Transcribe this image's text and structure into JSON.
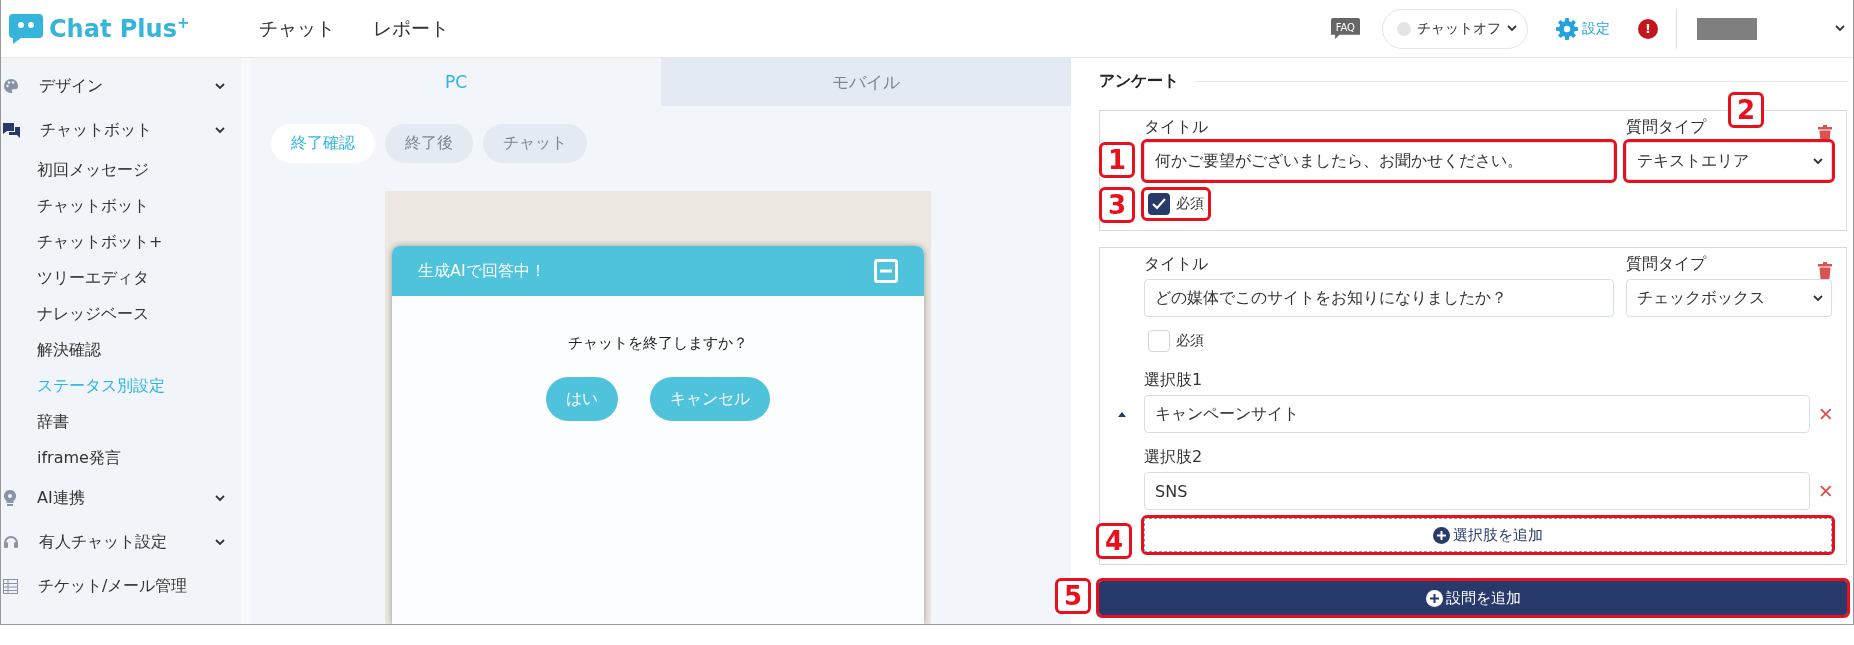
{
  "header": {
    "logo": "Chat Plus$^{+}$",
    "nav": [
      {
        "label": "チャット"
      },
      {
        "label": "レポート"
      }
    ],
    "faq": "FAQ",
    "status": {
      "label": "チャットオフ",
      "on": false
    },
    "settings": "設定",
    "alert": "!"
  },
  "sidebar": {
    "items": [
      {
        "label": "デザイン",
        "kind": "group"
      },
      {
        "label": "チャットボット",
        "kind": "group",
        "children": [
          {
            "label": "初回メッセージ",
            "selected": false
          },
          {
            "label": "チャットボット",
            "selected": false
          },
          {
            "label": "チャットボット+",
            "selected": false
          },
          {
            "label": "ツリーエディタ",
            "selected": false
          },
          {
            "label": "ナレッジベース",
            "selected": false
          },
          {
            "label": "解決確認",
            "selected": false
          },
          {
            "label": "ステータス別設定",
            "selected": true
          },
          {
            "label": "辞書",
            "selected": false
          },
          {
            "label": "iframe発言",
            "selected": false
          }
        ]
      },
      {
        "label": "AI連携",
        "kind": "group"
      },
      {
        "label": "有人チャット設定",
        "kind": "group"
      },
      {
        "label": "チケット/メール管理",
        "kind": "link"
      }
    ]
  },
  "device_tabs": [
    {
      "label": "PC",
      "selected": true
    },
    {
      "label": "モバイル",
      "selected": false
    }
  ],
  "screen_tabs": [
    {
      "label": "終了確認",
      "selected": true
    },
    {
      "label": "終了後",
      "selected": false
    },
    {
      "label": "チャット",
      "selected": false
    }
  ],
  "preview": {
    "title": "生成AIで回答中！",
    "message": "チャットを終了しますか？",
    "buttons": [
      "はい",
      "キャンセル"
    ]
  },
  "survey": {
    "heading": "アンケート",
    "questions": [
      {
        "title_label": "タイトル",
        "title": "何かご要望がございましたら、お聞かせください。",
        "type_label": "質問タイプ",
        "type": "テキストエリア",
        "required_label": "必須",
        "required": true,
        "callouts": {
          "title": "1",
          "type": "2",
          "required": "3"
        }
      },
      {
        "title_label": "タイトル",
        "title": "どの媒体でこのサイトをお知りになりましたか？",
        "type_label": "質問タイプ",
        "type": "チェックボックス",
        "required_label": "必須",
        "required": false,
        "options": [
          {
            "label": "選択肢1",
            "value": "キャンペーンサイト",
            "handle": true
          },
          {
            "label": "選択肢2",
            "value": "SNS",
            "handle": false
          }
        ],
        "add_option": "選択肢を追加",
        "callouts": {
          "add_option": "4"
        }
      }
    ],
    "add_question": "設問を追加",
    "add_question_callout": "5"
  }
}
